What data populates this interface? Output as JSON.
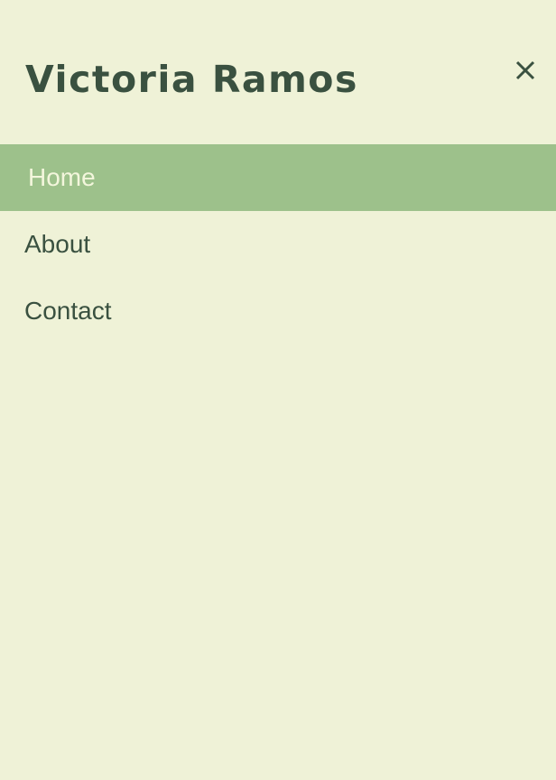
{
  "header": {
    "site_title": "Victoria Ramos",
    "close_icon": "close-icon"
  },
  "nav": {
    "items": [
      {
        "label": "Home",
        "active": true
      },
      {
        "label": "About",
        "active": false
      },
      {
        "label": "Contact",
        "active": false
      }
    ]
  },
  "colors": {
    "background": "#eff2d7",
    "text": "#3a5140",
    "active_background": "#9dc18b",
    "active_text": "#f3f6dc"
  }
}
